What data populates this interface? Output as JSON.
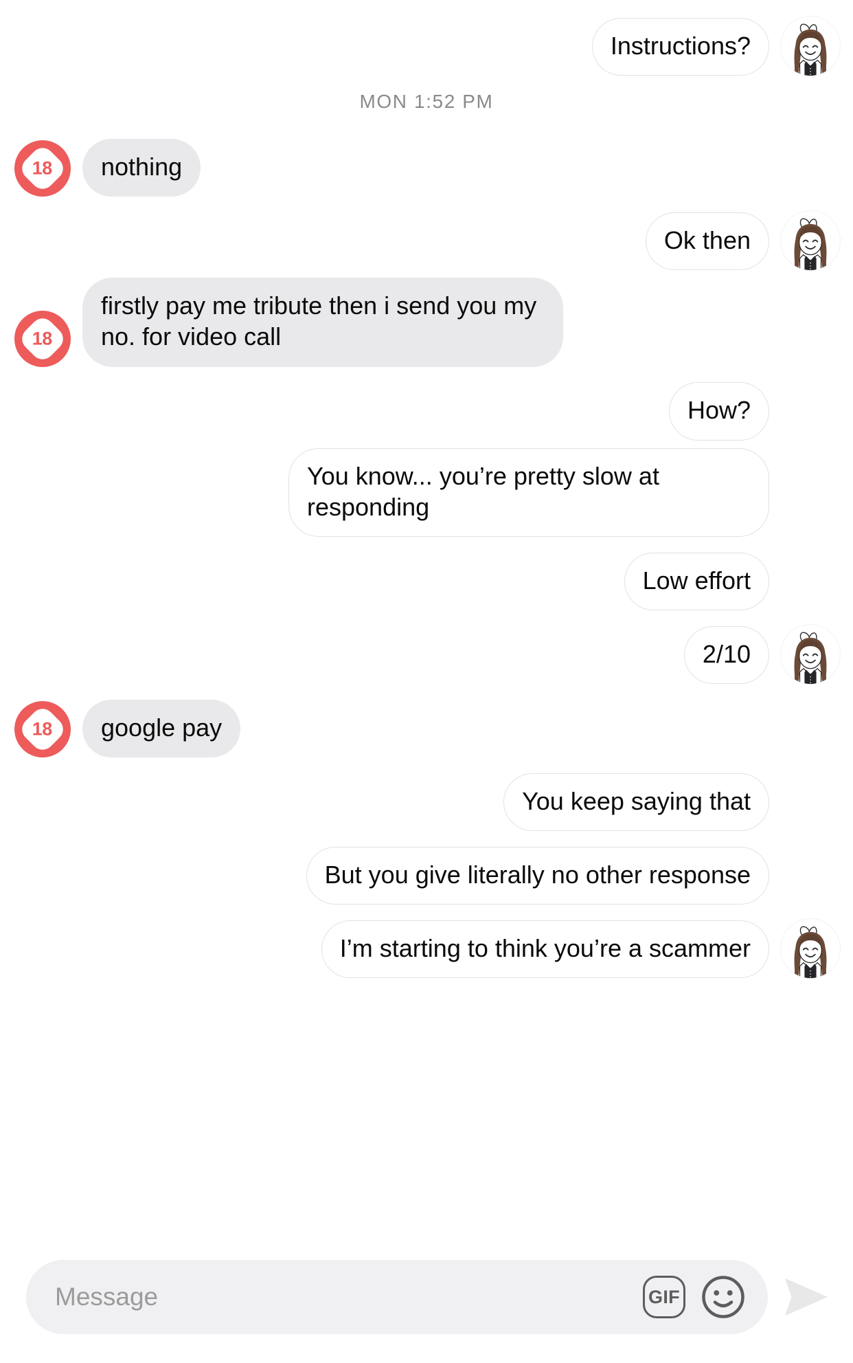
{
  "colors": {
    "badge_red": "#ed5b5b",
    "incoming_bubble": "#e9e9eb",
    "outgoing_bubble": "#ffffff",
    "outgoing_border": "#e2e2e2",
    "text": "#0a0a0a",
    "muted_text": "#8a8a8a",
    "placeholder": "#9b9b9b",
    "composer_bg": "#f0f0f2",
    "send_arrow": "#e8e8e8",
    "icon_gray": "#5c5c5c"
  },
  "avatars": {
    "incoming_label": "18",
    "incoming_name": "age-18-badge-avatar",
    "outgoing_name": "girl-cartoon-avatar"
  },
  "divider": {
    "label": "MON 1:52 PM"
  },
  "messages": [
    {
      "id": 0,
      "side": "outgoing",
      "text": "Instructions?",
      "avatar": true
    },
    {
      "id": 1,
      "side": "divider",
      "text": "MON 1:52 PM"
    },
    {
      "id": 2,
      "side": "incoming",
      "text": "nothing",
      "avatar": true
    },
    {
      "id": 3,
      "side": "outgoing",
      "text": "Ok then",
      "avatar": true
    },
    {
      "id": 4,
      "side": "incoming",
      "text": "firstly pay me tribute then i send you my no. for video call",
      "avatar": true
    },
    {
      "id": 5,
      "side": "outgoing",
      "text": "How?",
      "avatar": false
    },
    {
      "id": 6,
      "side": "outgoing",
      "text": "You know... you’re pretty slow at responding",
      "avatar": false
    },
    {
      "id": 7,
      "side": "outgoing",
      "text": "Low effort",
      "avatar": false
    },
    {
      "id": 8,
      "side": "outgoing",
      "text": "2/10",
      "avatar": true
    },
    {
      "id": 9,
      "side": "incoming",
      "text": "google pay",
      "avatar": true
    },
    {
      "id": 10,
      "side": "outgoing",
      "text": "You keep saying that",
      "avatar": false
    },
    {
      "id": 11,
      "side": "outgoing",
      "text": "But you give literally no other response",
      "avatar": false
    },
    {
      "id": 12,
      "side": "outgoing",
      "text": "I’m starting to think you’re a scammer",
      "avatar": true
    }
  ],
  "composer": {
    "placeholder": "Message",
    "value": "",
    "gif_label": "GIF",
    "emoji_name": "emoji-smiley-icon",
    "send_name": "send-icon"
  }
}
